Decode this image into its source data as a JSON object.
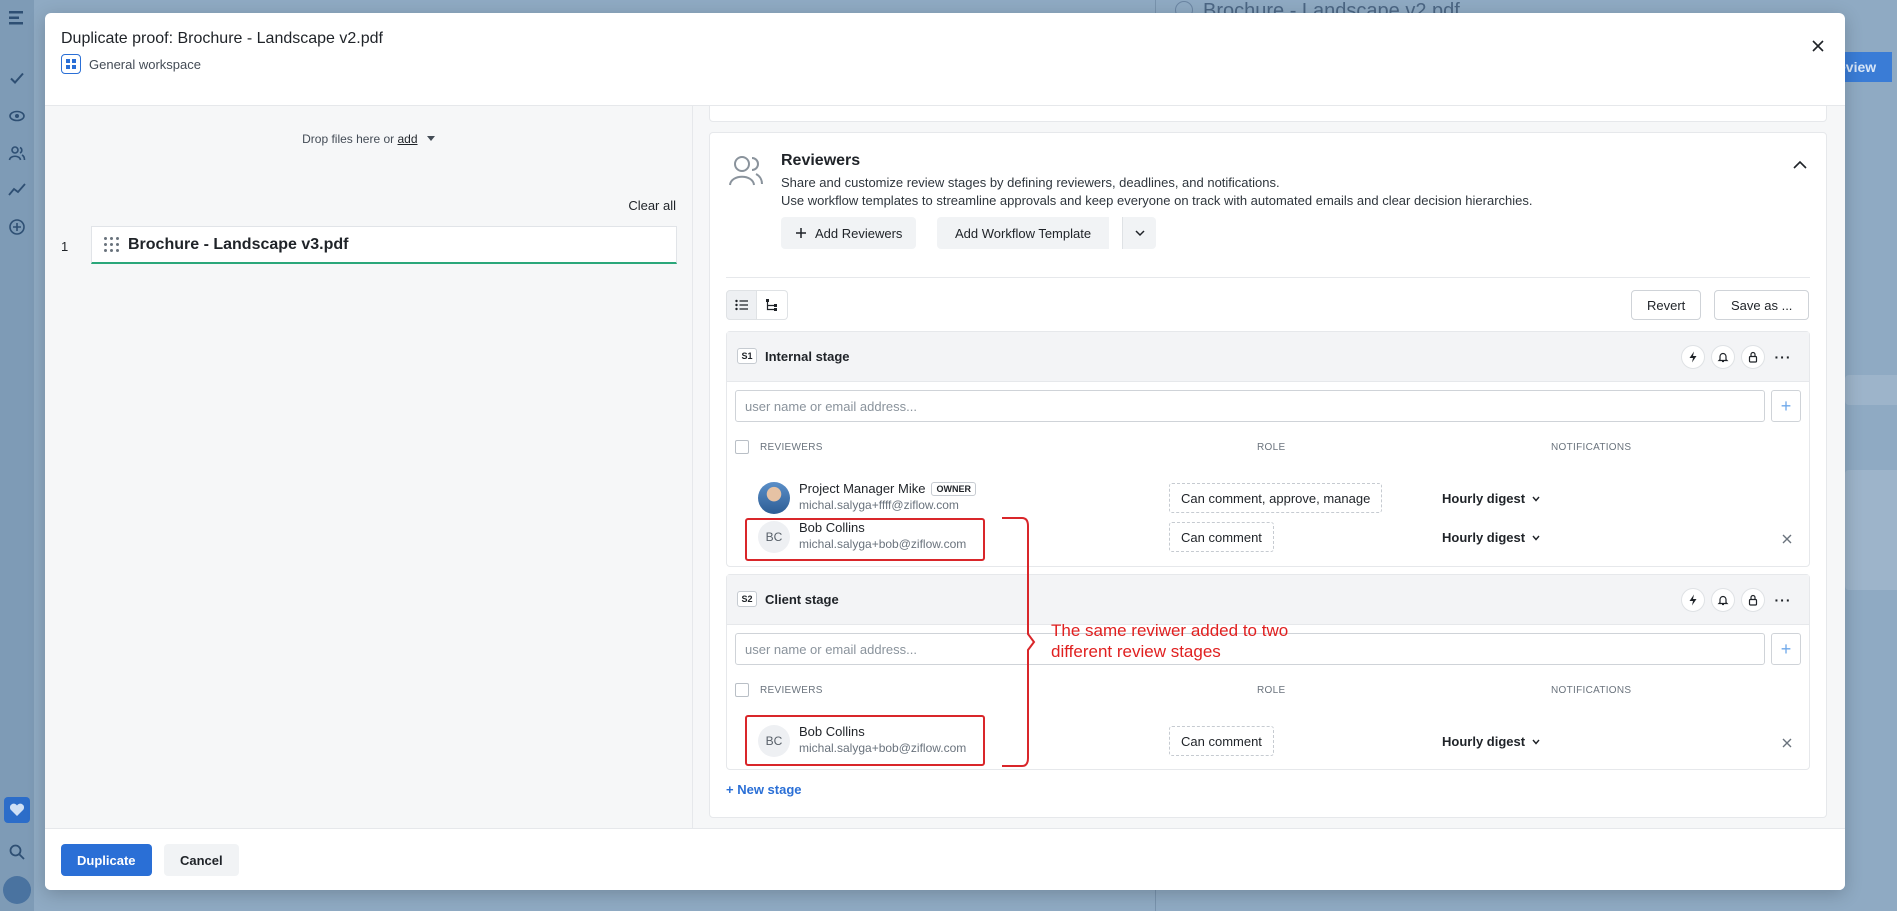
{
  "background": {
    "doc_title": "Brochure - Landscape v2.pdf",
    "review_btn_label": "eview"
  },
  "modal": {
    "title": "Duplicate proof:  Brochure - Landscape v2.pdf",
    "workspace": "General workspace"
  },
  "files": {
    "drop_text": "Drop files here or",
    "add_link": "add",
    "clear_all": "Clear all",
    "items": [
      {
        "index": "1",
        "name": "Brochure - Landscape v3.pdf"
      }
    ]
  },
  "reviewers": {
    "title": "Reviewers",
    "description_1": "Share and customize review stages by defining reviewers, deadlines, and notifications.",
    "description_2": "Use workflow templates to streamline approvals and keep everyone on track with automated emails and clear decision hierarchies.",
    "add_reviewers": "Add Reviewers",
    "add_template": "Add Workflow Template",
    "revert": "Revert",
    "save_as": "Save as ...",
    "new_stage": "+ New stage",
    "columns": {
      "reviewers": "REVIEWERS",
      "role": "ROLE",
      "notifications": "NOTIFICATIONS"
    },
    "input_placeholder": "user name or email address...",
    "stages": [
      {
        "badge": "S1",
        "name": "Internal stage",
        "people": [
          {
            "name": "Project Manager Mike",
            "tag": "OWNER",
            "email": "michal.salyga+ffff@ziflow.com",
            "role": "Can comment, approve, manage",
            "notification": "Hourly digest"
          },
          {
            "initials": "BC",
            "name": "Bob Collins",
            "email": "michal.salyga+bob@ziflow.com",
            "role": "Can comment",
            "notification": "Hourly digest"
          }
        ]
      },
      {
        "badge": "S2",
        "name": "Client stage",
        "people": [
          {
            "initials": "BC",
            "name": "Bob Collins",
            "email": "michal.salyga+bob@ziflow.com",
            "role": "Can comment",
            "notification": "Hourly digest"
          }
        ]
      }
    ]
  },
  "annotation": {
    "text_line_1": "The same reviwer added to two",
    "text_line_2": "different review stages",
    "color": "#e02020"
  },
  "footer": {
    "duplicate": "Duplicate",
    "cancel": "Cancel"
  },
  "colors": {
    "primary": "#2a6fd6",
    "file_underline": "#2aa77a"
  }
}
